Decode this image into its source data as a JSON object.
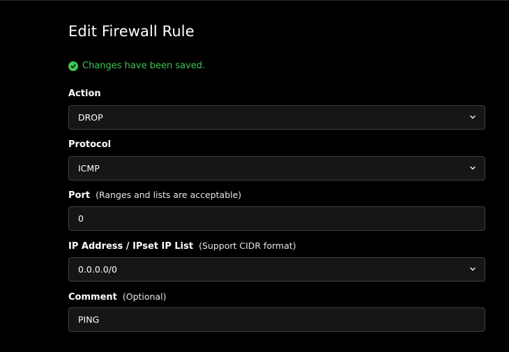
{
  "form": {
    "title": "Edit Firewall Rule",
    "status": {
      "message": "Changes have been saved.",
      "icon": "check-circle-icon",
      "color": "#3ec455"
    },
    "fields": {
      "action": {
        "label": "Action",
        "value": "DROP"
      },
      "protocol": {
        "label": "Protocol",
        "value": "ICMP"
      },
      "port": {
        "label": "Port",
        "hint": "(Ranges and lists are acceptable)",
        "value": "0"
      },
      "ip": {
        "label": "IP Address / IPset IP List",
        "hint": "(Support CIDR format)",
        "value": "0.0.0.0/0"
      },
      "comment": {
        "label": "Comment",
        "hint": "(Optional)",
        "value": "PING"
      }
    }
  }
}
